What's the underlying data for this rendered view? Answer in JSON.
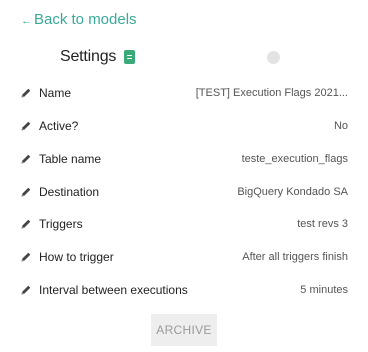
{
  "nav": {
    "back_arrow": "←",
    "back_label": "Back to models"
  },
  "header": {
    "title": "Settings"
  },
  "colors": {
    "accent": "#3aaa98",
    "doc_icon": "#3aaa78",
    "pencil": "#444444"
  },
  "settings": [
    {
      "label": "Name",
      "value": "[TEST] Execution Flags 2021..."
    },
    {
      "label": "Active?",
      "value": "No"
    },
    {
      "label": "Table name",
      "value": "teste_execution_flags"
    },
    {
      "label": "Destination",
      "value": "BigQuery Kondado SA"
    },
    {
      "label": "Triggers",
      "value": "test revs 3"
    },
    {
      "label": "How to trigger",
      "value": "After all triggers finish"
    },
    {
      "label": "Interval between executions",
      "value": "5 minutes"
    }
  ],
  "actions": {
    "archive_label": "ARCHIVE"
  }
}
